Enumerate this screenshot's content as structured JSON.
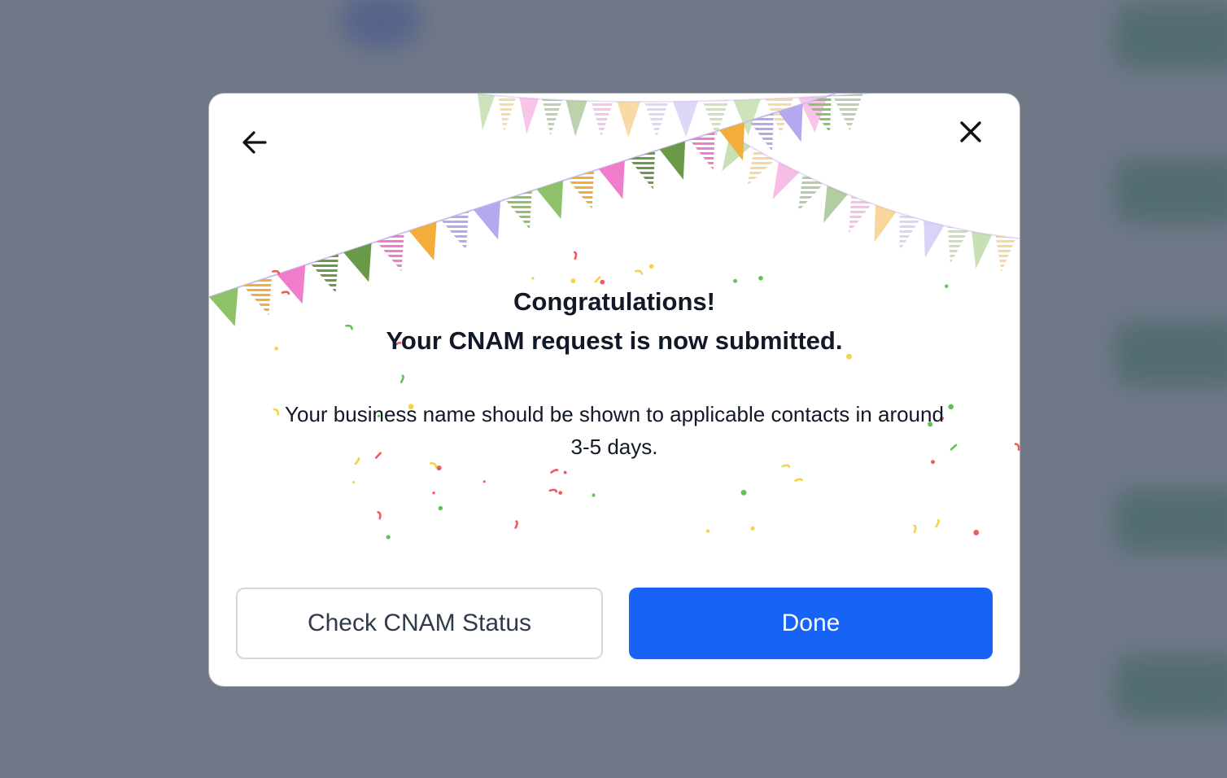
{
  "modal": {
    "title_line1": "Congratulations!",
    "title_line2": "Your CNAM request is now submitted.",
    "message": "Your business name should be shown to applicable contacts in around 3-5 days.",
    "icons": {
      "back": "arrow-left-icon",
      "close": "close-icon"
    }
  },
  "actions": {
    "secondary_label": "Check CNAM Status",
    "primary_label": "Done"
  },
  "colors": {
    "primary": "#1763f5",
    "overlay": "#707888",
    "text": "#111827",
    "secondary_border": "#d4d7dd"
  }
}
